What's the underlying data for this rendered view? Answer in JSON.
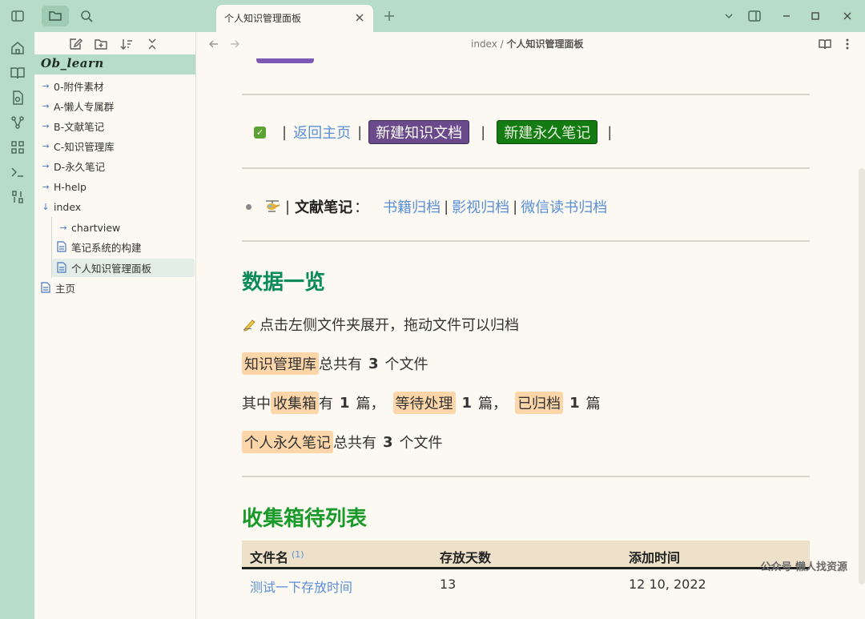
{
  "tabs": [
    {
      "title": "个人知识管理面板"
    }
  ],
  "sidebar": {
    "vault_name": "Ob_learn",
    "items": [
      {
        "label": "0-附件素材"
      },
      {
        "label": "A-懒人专属群"
      },
      {
        "label": "B-文献笔记"
      },
      {
        "label": "C-知识管理库"
      },
      {
        "label": "D-永久笔记"
      },
      {
        "label": "H-help"
      },
      {
        "label": "index"
      },
      {
        "label": "chartview"
      },
      {
        "label": "笔记系统的构建"
      },
      {
        "label": "个人知识管理面板"
      },
      {
        "label": "主页"
      }
    ]
  },
  "breadcrumb": {
    "parent": "index",
    "separator": "/",
    "current": "个人知识管理面板"
  },
  "nav": {
    "sep": "|",
    "back_home": "返回主页",
    "new_knowledge": "新建知识文档",
    "new_permanent": "新建永久笔记"
  },
  "literature": {
    "label": "文献笔记",
    "colon": "：",
    "sep": "|",
    "books": "书籍归档",
    "media": "影视归档",
    "wechat": "微信读书归档"
  },
  "overview": {
    "title": "数据一览",
    "tip": "点击左侧文件夹展开，拖动文件可以归档",
    "kb_label": "知识管理库",
    "kb_text1": "总共有",
    "kb_count": "3",
    "kb_text2": "个文件",
    "among": "其中",
    "inbox": "收集箱",
    "has": "有",
    "inbox_count": "1",
    "pian_comma": "篇，",
    "pending": "等待处理",
    "pending_count": "1",
    "archived": "已归档",
    "archived_count": "1",
    "pian": "篇",
    "perm_label": "个人永久笔记",
    "perm_text1": "总共有",
    "perm_count": "3",
    "perm_text2": "个文件"
  },
  "inbox_list": {
    "title": "收集箱待列表",
    "headers": [
      "文件名",
      "存放天数",
      "添加时间"
    ],
    "header_sup": "(1)",
    "rows": [
      [
        "测试一下存放时间",
        "13",
        "12 10, 2022"
      ]
    ]
  },
  "watermark": "公众号 懒人找资源",
  "colors": {
    "accent_green": "#0b8a5a",
    "heading_green": "#1a9a2a",
    "link_blue": "#5b8fd8",
    "highlight": "#fcd6a8",
    "purple_button": "#6b4a8c",
    "green_button": "#147a12"
  }
}
